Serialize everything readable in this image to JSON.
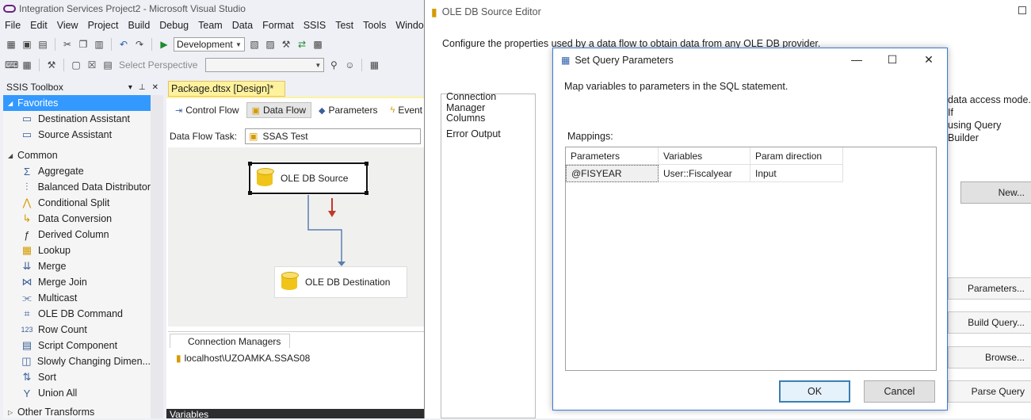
{
  "vs": {
    "title": "Integration Services Project2 - Microsoft Visual Studio",
    "menu": [
      "File",
      "Edit",
      "View",
      "Project",
      "Build",
      "Debug",
      "Team",
      "Data",
      "Format",
      "SSIS",
      "Test",
      "Tools",
      "Windo"
    ],
    "config": "Development",
    "perspective_label": "Select Perspective"
  },
  "toolbox": {
    "title": "SSIS Toolbox",
    "favorites_label": "Favorites",
    "favorites": [
      "Destination Assistant",
      "Source Assistant"
    ],
    "common_label": "Common",
    "common": [
      "Aggregate",
      "Balanced Data Distributor",
      "Conditional Split",
      "Data Conversion",
      "Derived Column",
      "Lookup",
      "Merge",
      "Merge Join",
      "Multicast",
      "OLE DB Command",
      "Row Count",
      "Script Component",
      "Slowly Changing Dimen...",
      "Sort",
      "Union All"
    ],
    "other_label": "Other Transforms"
  },
  "designer": {
    "doc_tab": "Package.dtsx [Design]*",
    "tabs": [
      "Control Flow",
      "Data Flow",
      "Parameters",
      "Event"
    ],
    "dft_label": "Data Flow Task:",
    "dft_value": "SSAS Test",
    "source_node": "OLE DB Source",
    "dest_node": "OLE DB Destination",
    "conn_tab": "Connection Managers",
    "conn_item": "localhost\\UZOAMKA.SSAS08",
    "variables_label": "Variables"
  },
  "source_editor": {
    "title": "OLE DB Source Editor",
    "description": "Configure the properties used by a data flow to obtain data from any OLE DB provider.",
    "nav": [
      "Connection Manager",
      "Columns",
      "Error Output"
    ],
    "right_text": [
      "data access mode. If",
      "using Query Builder"
    ],
    "buttons": {
      "new": "New...",
      "parameters": "Parameters...",
      "build_query": "Build Query...",
      "browse": "Browse...",
      "parse_query": "Parse Query"
    }
  },
  "dialog": {
    "title": "Set Query Parameters",
    "description": "Map variables to parameters in the SQL statement.",
    "mappings_label": "Mappings:",
    "columns": [
      "Parameters",
      "Variables",
      "Param direction"
    ],
    "rows": [
      {
        "parameter": "@FISYEAR",
        "variable": "User::Fiscalyear",
        "direction": "Input"
      }
    ],
    "ok": "OK",
    "cancel": "Cancel"
  }
}
